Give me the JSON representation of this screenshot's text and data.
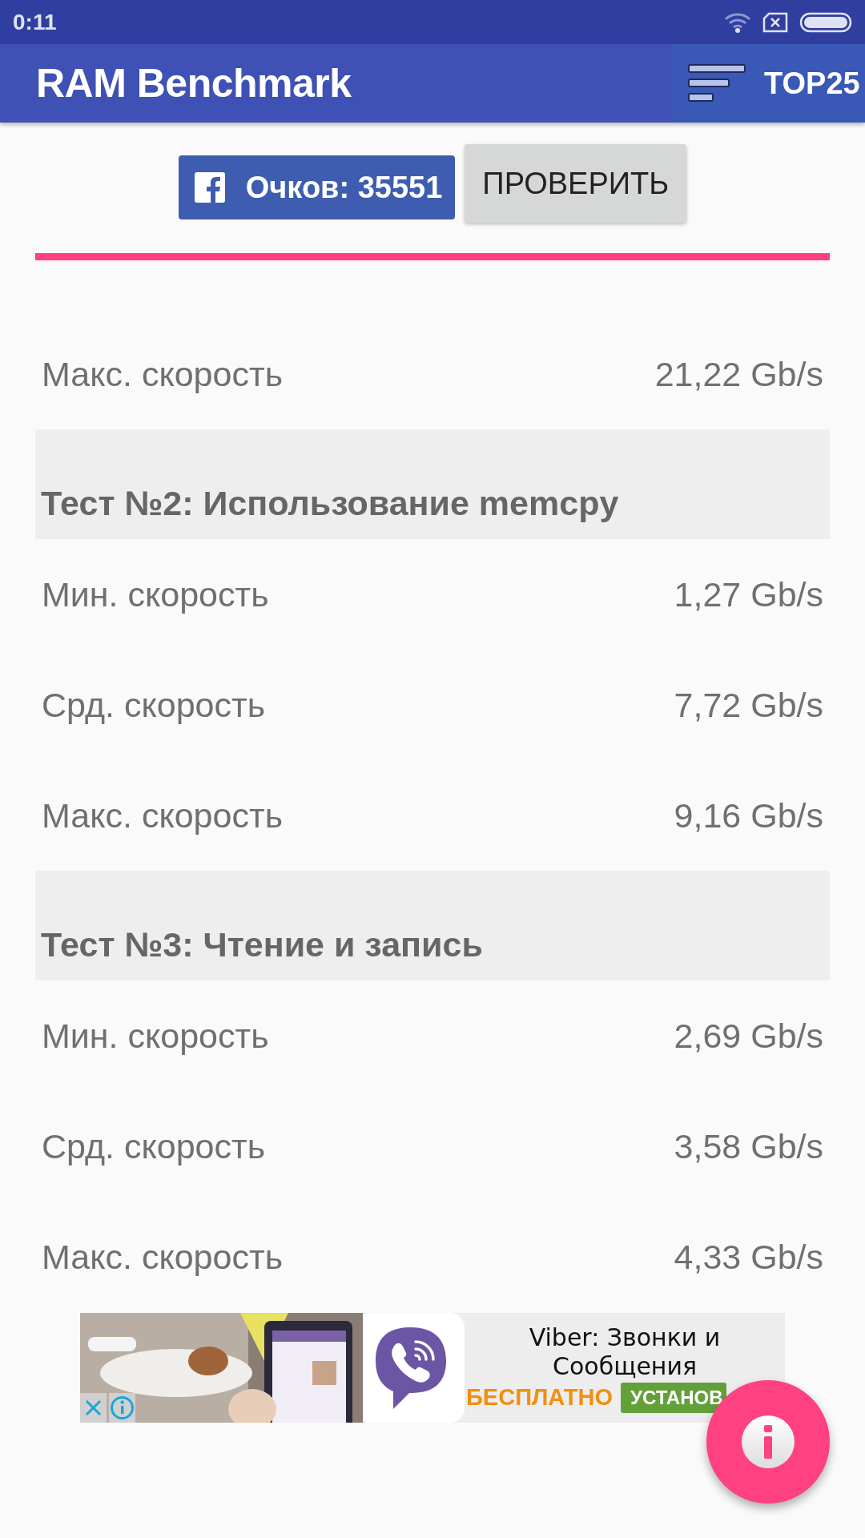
{
  "status_bar": {
    "time": "0:11"
  },
  "app_bar": {
    "title": "RAM Benchmark",
    "top_button": "TOP25"
  },
  "score": {
    "share_button": "Очков: 35551",
    "check_button": "ПРОВЕРИТЬ"
  },
  "results": [
    {
      "kind": "row",
      "label": "Макс. скорость",
      "value": "21,22 Gb/s"
    },
    {
      "kind": "header",
      "label": "Тест №2: Использование memcpy"
    },
    {
      "kind": "row",
      "label": "Мин. скорость",
      "value": "1,27 Gb/s"
    },
    {
      "kind": "row",
      "label": "Срд. скорость",
      "value": "7,72 Gb/s"
    },
    {
      "kind": "row",
      "label": "Макс. скорость",
      "value": "9,16 Gb/s"
    },
    {
      "kind": "header",
      "label": "Тест №3: Чтение и запись"
    },
    {
      "kind": "row",
      "label": "Мин. скорость",
      "value": "2,69 Gb/s"
    },
    {
      "kind": "row",
      "label": "Срд. скорость",
      "value": "3,58 Gb/s"
    },
    {
      "kind": "row",
      "label": "Макс. скорость",
      "value": "4,33 Gb/s"
    }
  ],
  "ad": {
    "title": "Viber: Звонки и Сообщения",
    "price": "БЕСПЛАТНО",
    "install": "УСТАНОВ"
  }
}
